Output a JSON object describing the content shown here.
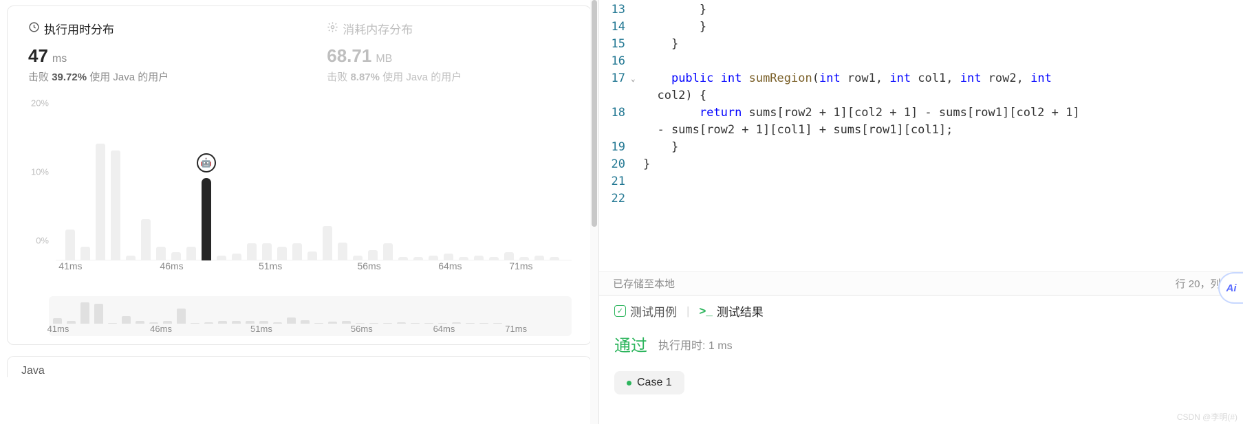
{
  "left": {
    "runtime_title": "执行用时分布",
    "memory_title": "消耗内存分布",
    "runtime_value": "47",
    "runtime_unit": "ms",
    "memory_value": "68.71",
    "memory_unit": "MB",
    "beats_prefix": "击败",
    "beats_runtime_pct": "39.72%",
    "beats_memory_pct": "8.87%",
    "beats_suffix": "使用 Java 的用户",
    "language": "Java"
  },
  "chart_data": {
    "type": "bar",
    "xlabel": "",
    "ylabel": "",
    "ylim": [
      0,
      20
    ],
    "y_ticks": [
      "0%",
      "10%",
      "20%"
    ],
    "x_ticks": [
      "41ms",
      "46ms",
      "51ms",
      "56ms",
      "64ms",
      "71ms"
    ],
    "x_positions_pct": [
      1,
      21,
      40.5,
      60,
      76,
      90
    ],
    "values": [
      4.5,
      2,
      17,
      16,
      0.7,
      6,
      2,
      1.2,
      2,
      12,
      0.7,
      1,
      2.5,
      2.5,
      2,
      2.5,
      1.3,
      5,
      2.6,
      0.7,
      1.5,
      2.5,
      0.5,
      0.5,
      0.7,
      1,
      0.5,
      0.7,
      0.5,
      1.2,
      0.5,
      0.7,
      0.5
    ],
    "mine_index": 9,
    "marker_emoji": "🤖"
  },
  "mini_chart": {
    "values": [
      4.5,
      2,
      17,
      16,
      0.7,
      6,
      2,
      1.2,
      2,
      12,
      0.7,
      1,
      2.5,
      2.5,
      2,
      2.5,
      1.3,
      5,
      2.6,
      0.7,
      1.5,
      2.5,
      0.5,
      0.5,
      0.7,
      1,
      0.5,
      0.7,
      0.5,
      1.2,
      0.5,
      0.7,
      0.5
    ],
    "x_ticks": [
      "41ms",
      "46ms",
      "51ms",
      "56ms",
      "64ms",
      "71ms"
    ],
    "x_positions_pct": [
      1,
      21,
      40.5,
      60,
      76,
      90
    ]
  },
  "code": {
    "lines": [
      {
        "ln": "13",
        "segs": [
          [
            "        }",
            ""
          ]
        ]
      },
      {
        "ln": "14",
        "segs": [
          [
            "        }",
            ""
          ]
        ]
      },
      {
        "ln": "15",
        "segs": [
          [
            "    }",
            ""
          ]
        ]
      },
      {
        "ln": "16",
        "segs": [
          [
            "",
            ""
          ]
        ]
      },
      {
        "ln": "17",
        "fold": true,
        "segs": [
          [
            "    ",
            ""
          ],
          [
            "public",
            "kw"
          ],
          [
            " ",
            ""
          ],
          [
            "int",
            "kw"
          ],
          [
            " ",
            ""
          ],
          [
            "sumRegion",
            "fn"
          ],
          [
            "(",
            ""
          ],
          [
            "int",
            "kw"
          ],
          [
            " row1, ",
            ""
          ],
          [
            "int",
            "kw"
          ],
          [
            " col1, ",
            ""
          ],
          [
            "int",
            "kw"
          ],
          [
            " row2, ",
            ""
          ],
          [
            "int",
            "kw"
          ],
          [
            " ",
            ""
          ]
        ],
        "wrap": "col2) {"
      },
      {
        "ln": "18",
        "segs": [
          [
            "        ",
            ""
          ],
          [
            "return",
            "kw"
          ],
          [
            " sums[row2 + 1][col2 + 1] - sums[row1][col2 + 1] ",
            ""
          ]
        ],
        "wrap": "- sums[row2 + 1][col1] + sums[row1][col1];"
      },
      {
        "ln": "19",
        "segs": [
          [
            "    }",
            ""
          ]
        ]
      },
      {
        "ln": "20",
        "segs": [
          [
            "}",
            ""
          ]
        ]
      },
      {
        "ln": "21",
        "segs": [
          [
            "",
            ""
          ]
        ]
      },
      {
        "ln": "22",
        "segs": [
          [
            "",
            ""
          ]
        ]
      }
    ]
  },
  "status": {
    "saved": "已存储至本地",
    "cursor": "行 20，列 2"
  },
  "result": {
    "tab_test": "测试用例",
    "tab_result": "测试结果",
    "pass": "通过",
    "runtime_label": "执行用时: 1 ms",
    "case_label": "Case 1"
  },
  "ai_label": "Ai",
  "watermark": "CSDN @李明(#)"
}
